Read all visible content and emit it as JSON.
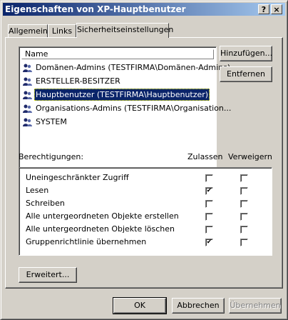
{
  "window": {
    "title": "Eigenschaften von XP-Hauptbenutzer",
    "help_glyph": "?",
    "close_glyph": "×"
  },
  "tabs": [
    {
      "label": "Allgemein"
    },
    {
      "label": "Links"
    },
    {
      "label": "Sicherheitseinstellungen",
      "selected": true
    }
  ],
  "principals": {
    "column_header": "Name",
    "items": [
      {
        "label": "Domänen-Admins (TESTFIRMA\\Domänen-Admins)",
        "icon": "group-icon"
      },
      {
        "label": "ERSTELLER-BESITZER",
        "icon": "group-icon"
      },
      {
        "label": "Hauptbenutzer (TESTFIRMA\\Hauptbenutzer)",
        "icon": "group-icon",
        "selected": true
      },
      {
        "label": "Organisations-Admins (TESTFIRMA\\Organisation...",
        "icon": "group-icon"
      },
      {
        "label": "SYSTEM",
        "icon": "group-icon"
      }
    ],
    "add_button": "Hinzufügen...",
    "remove_button": "Entfernen"
  },
  "permissions": {
    "label": "Berechtigungen:",
    "allow_header": "Zulassen",
    "deny_header": "Verweigern",
    "rows": [
      {
        "label": "Uneingeschränkter Zugriff",
        "allow": false,
        "deny": false
      },
      {
        "label": "Lesen",
        "allow": true,
        "deny": false
      },
      {
        "label": "Schreiben",
        "allow": false,
        "deny": false
      },
      {
        "label": "Alle untergeordneten Objekte erstellen",
        "allow": false,
        "deny": false
      },
      {
        "label": "Alle untergeordneten Objekte löschen",
        "allow": false,
        "deny": false
      },
      {
        "label": "Gruppenrichtlinie übernehmen",
        "allow": true,
        "deny": false
      }
    ],
    "check_glyph": "✔"
  },
  "advanced_button": "Erweitert...",
  "footer": {
    "ok": "OK",
    "cancel": "Abbrechen",
    "apply": "Übernehmen"
  }
}
